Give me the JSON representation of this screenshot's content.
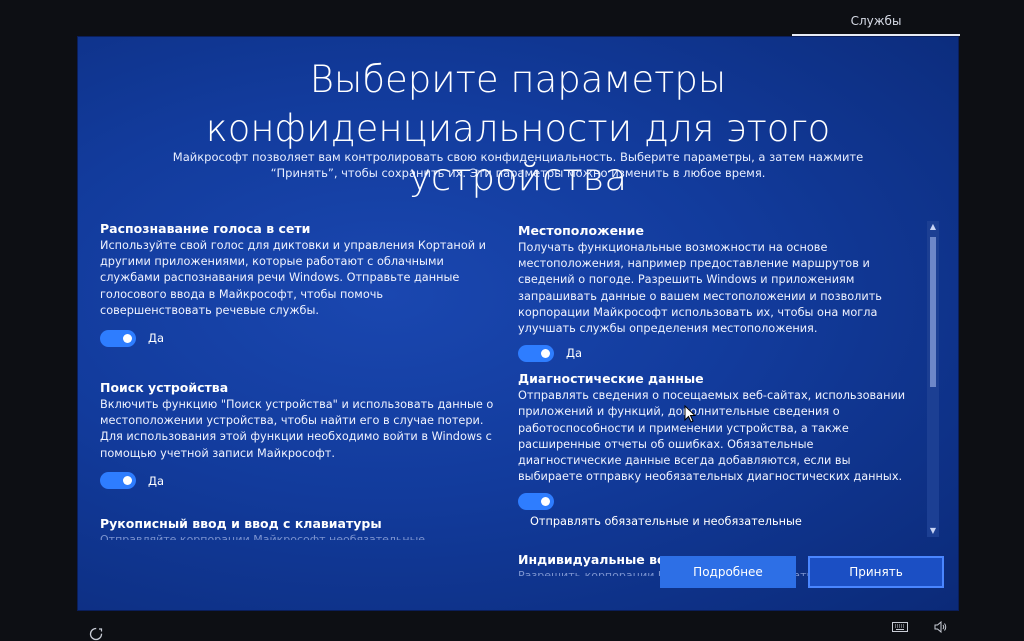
{
  "top_tab": {
    "label": "Службы"
  },
  "header": {
    "title": "Выберите параметры конфиденциальности для этого устройства",
    "subtitle": "Майкрософт позволяет вам контролировать свою конфиденциальность. Выберите параметры, а затем нажмите “Принять”, чтобы сохранить их. Эти параметры можно изменить в любое время."
  },
  "left_column": [
    {
      "title": "Распознавание голоса в сети",
      "description": "Используйте свой голос для диктовки и управления Кортаной и другими приложениями, которые работают с облачными службами распознавания речи Windows. Отправьте данные голосового ввода в Майкрософт, чтобы помочь совершенствовать речевые службы.",
      "toggle_label": "Да",
      "toggle_on": true
    },
    {
      "title": "Поиск устройства",
      "description": "Включить функцию \"Поиск устройства\" и использовать данные о местоположении устройства, чтобы найти его в случае потери. Для использования этой функции необходимо войти в Windows с помощью учетной записи Майкрософт.",
      "toggle_label": "Да",
      "toggle_on": true
    },
    {
      "title": "Рукописный ввод и ввод с клавиатуры",
      "description": "Отправляйте корпорации Майкрософт необязательные"
    }
  ],
  "right_column": [
    {
      "title": "Местоположение",
      "description": "Получать функциональные возможности на основе местоположения, например предоставление маршрутов и сведений о погоде. Разрешить Windows и приложениям запрашивать данные о вашем местоположении и позволить корпорации Майкрософт использовать их, чтобы она могла улучшать службы определения местоположения.",
      "toggle_label": "Да",
      "toggle_on": true
    },
    {
      "title": "Диагностические данные",
      "description": "Отправлять сведения о посещаемых веб-сайтах, использовании приложений и функций, дополнительные сведения о работоспособности и применении устройства, а также расширенные отчеты об ошибках. Обязательные диагностические данные всегда добавляются, если вы выбираете отправку необязательных диагностических данных.",
      "toggle_label": "Отправлять обязательные и необязательные диагностические данные",
      "toggle_on": true
    },
    {
      "title": "Индивидуальные возможности",
      "description": "Разрешить корпорации Майкрософт использовать ваши"
    }
  ],
  "buttons": {
    "more": "Подробнее",
    "accept": "Принять"
  },
  "icons": {
    "ease_of_access": "ease-of-access-icon",
    "keyboard": "keyboard-icon",
    "volume": "volume-icon"
  },
  "colors": {
    "panel_blue": "#123b9c",
    "toggle_on": "#2e7dff",
    "button_more": "#2d6fe6",
    "button_accept": "#1b4fc4"
  }
}
